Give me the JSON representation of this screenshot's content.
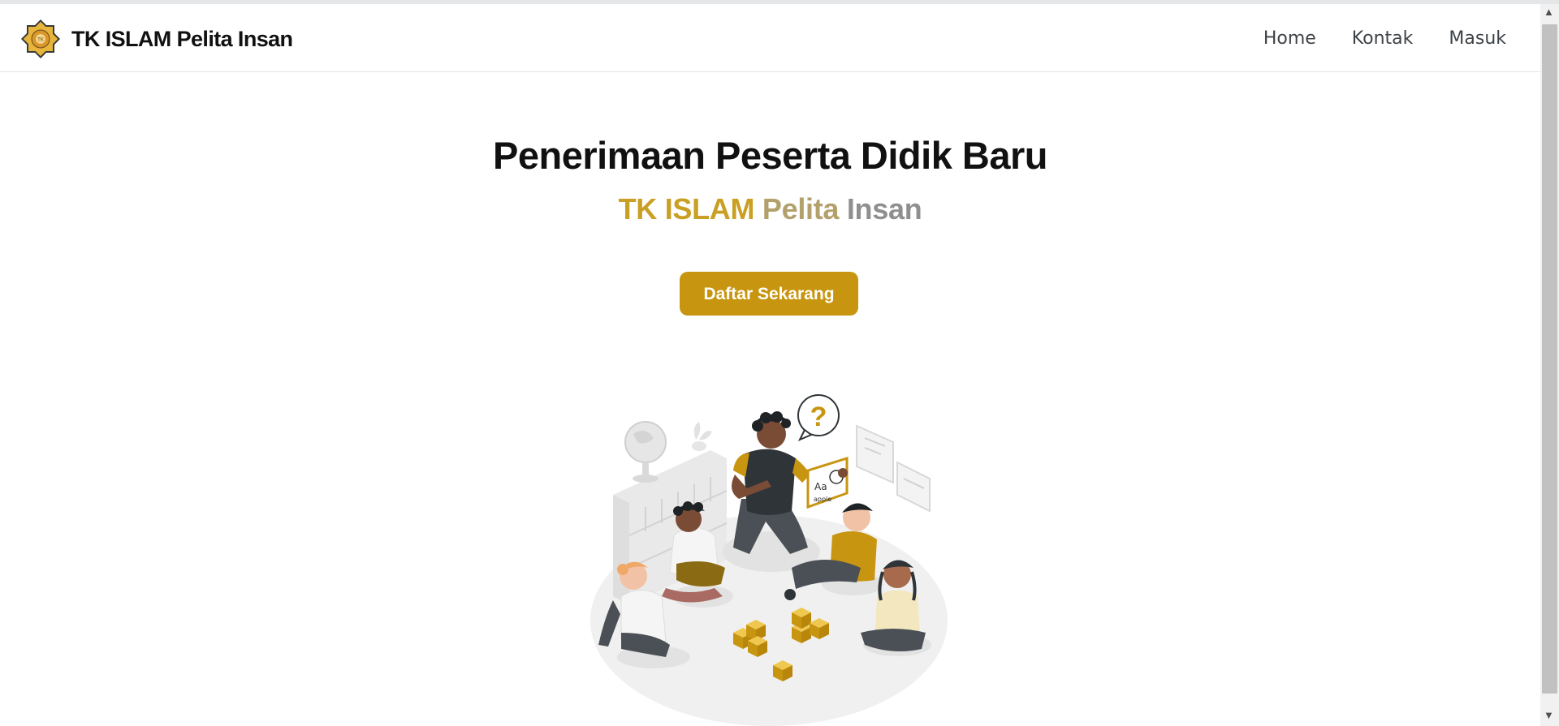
{
  "header": {
    "brand_name": "TK ISLAM Pelita Insan",
    "nav": [
      {
        "label": "Home"
      },
      {
        "label": "Kontak"
      },
      {
        "label": "Masuk"
      }
    ]
  },
  "hero": {
    "title": "Penerimaan Peserta Didik Baru",
    "subtitle_parts": [
      "TK ISLAM",
      "Pelita",
      "Insan"
    ],
    "cta_label": "Daftar Sekarang",
    "illustration": {
      "speech_bubble": "?",
      "card_text_1": "Aa",
      "card_text_2": "apple"
    }
  },
  "colors": {
    "accent": "#c7950f",
    "subtitle_gold": "#c9a023",
    "subtitle_muted": "#b3a16b",
    "subtitle_gray": "#8f8f8f",
    "title": "#111111"
  },
  "icons": {
    "logo": "star-lantern-logo",
    "scroll_up": "arrow-up-icon",
    "scroll_down": "arrow-down-icon"
  }
}
